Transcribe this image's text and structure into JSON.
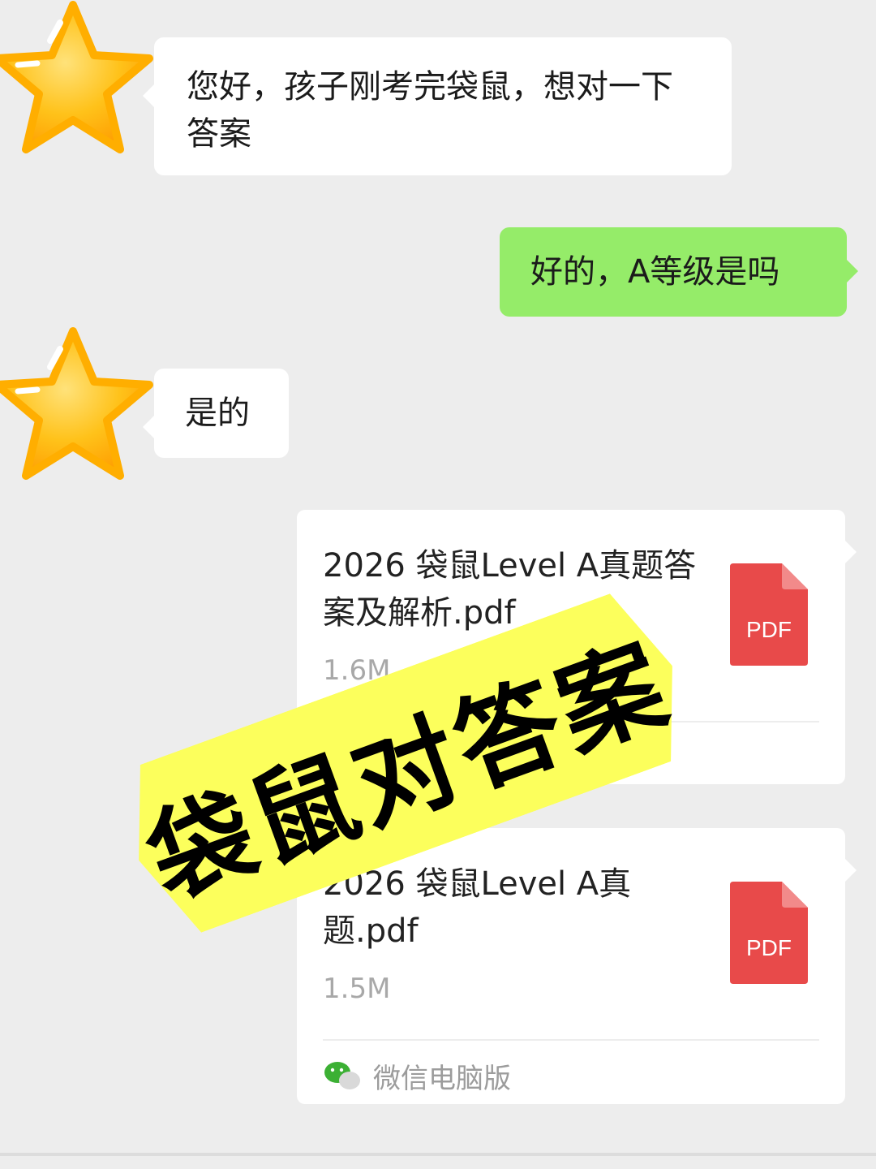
{
  "messages": [
    {
      "side": "left",
      "text": "您好，孩子刚考完袋鼠，想对一下答案"
    },
    {
      "side": "right",
      "text": "好的，A等级是吗"
    },
    {
      "side": "left",
      "text": "是的"
    }
  ],
  "files": [
    {
      "name": "2026 袋鼠Level A真题答案及解析.pdf",
      "size": "1.6M",
      "icon_label": "PDF"
    },
    {
      "name": "2026 袋鼠Level A真题.pdf",
      "size": "1.5M",
      "icon_label": "PDF",
      "footer": "微信电脑版"
    }
  ],
  "banner": {
    "text": "袋鼠对答案",
    "color": "#fcff5c"
  },
  "colors": {
    "background": "#ededed",
    "outgoing_bubble": "#95ec69",
    "pdf_red": "#e84a4a",
    "star": "#ffb300"
  },
  "icons": {
    "avatar": "star-icon",
    "file": "pdf-icon",
    "footer": "wechat-icon"
  }
}
